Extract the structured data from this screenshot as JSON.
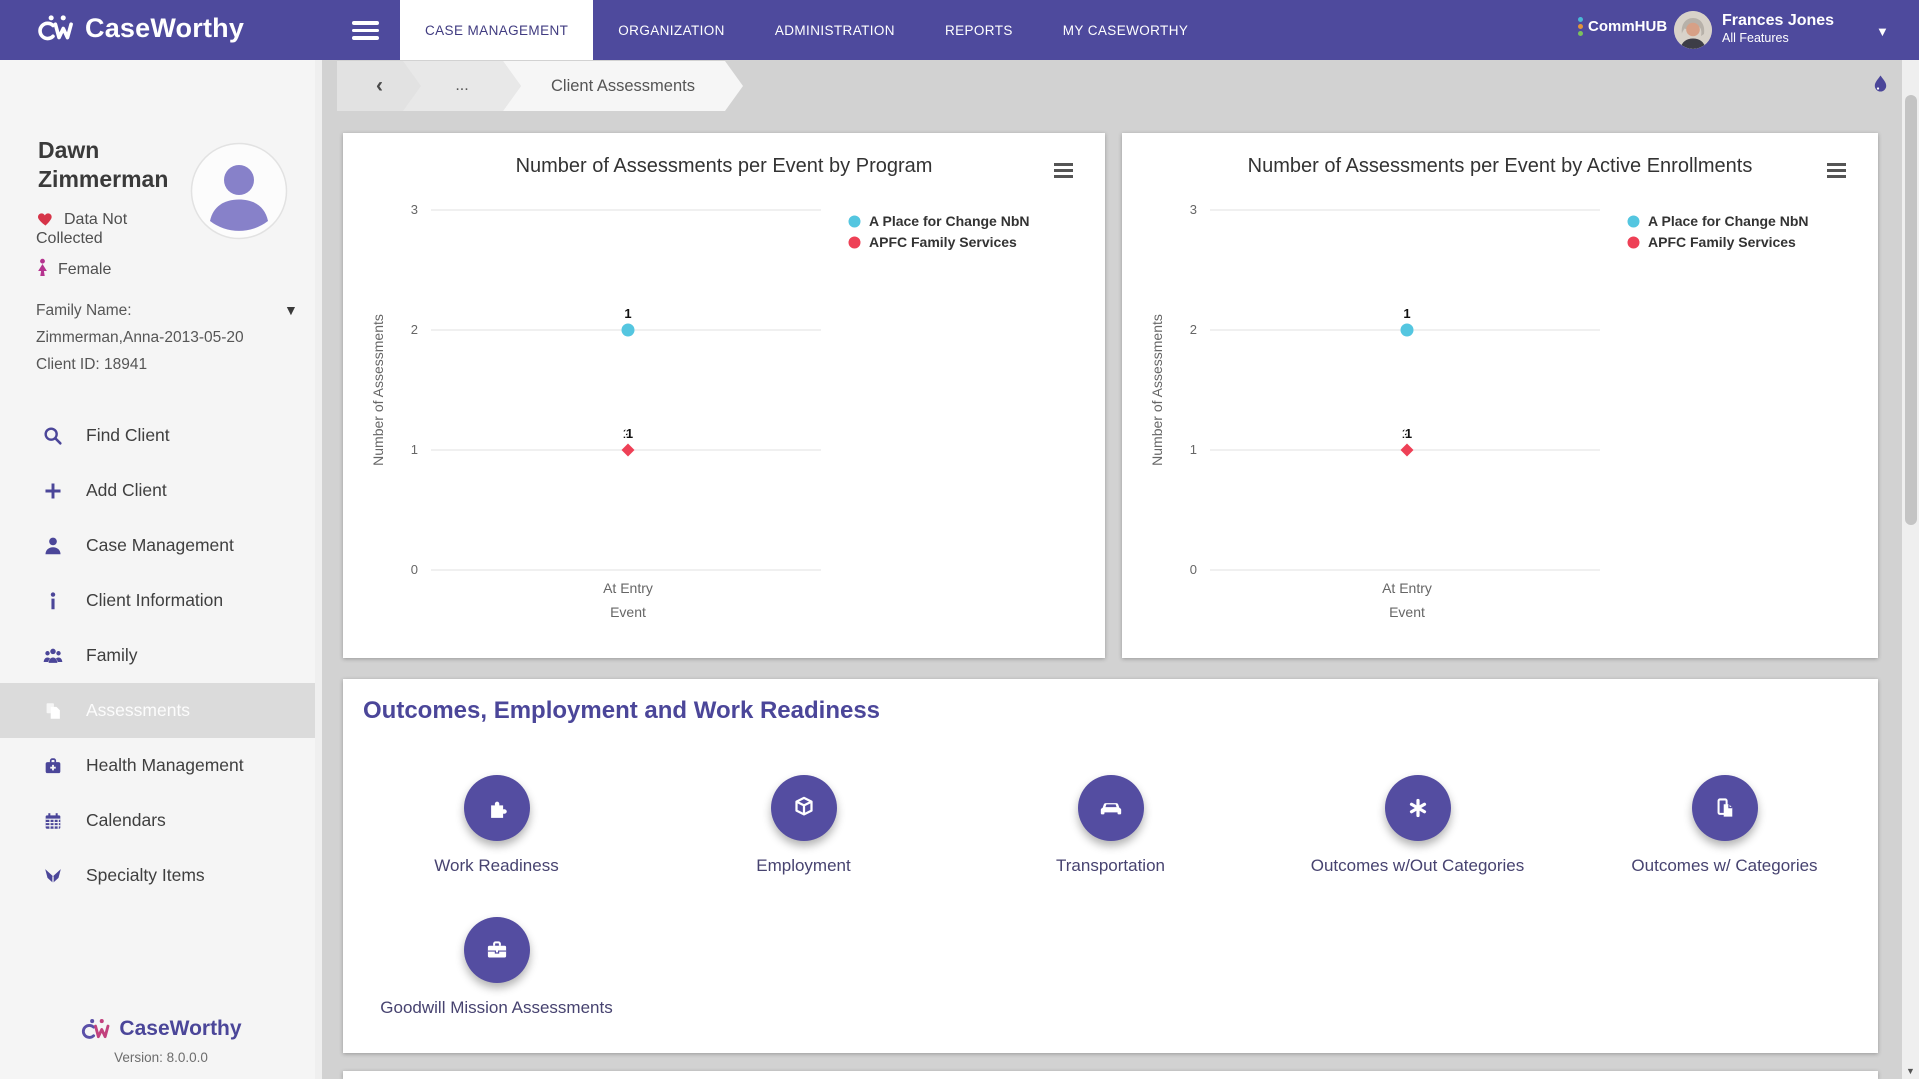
{
  "navbar": {
    "brand": "CaseWorthy",
    "tabs": [
      {
        "label": "CASE MANAGEMENT",
        "active": true
      },
      {
        "label": "ORGANIZATION",
        "active": false
      },
      {
        "label": "ADMINISTRATION",
        "active": false
      },
      {
        "label": "REPORTS",
        "active": false
      },
      {
        "label": "MY CASEWORTHY",
        "active": false
      }
    ],
    "commhub_label": "CommHUB",
    "user": {
      "name": "Frances Jones",
      "subtitle": "All Features"
    },
    "colors": {
      "bar": "#4e4a9d",
      "active_tab_text": "#403b80"
    }
  },
  "sidebar": {
    "client": {
      "name_line1": "Dawn",
      "name_line2": "Zimmerman",
      "health_status": "Data Not Collected",
      "gender": "Female",
      "family_label": "Family Name:",
      "family_value": "Zimmerman,Anna-2013-05-20",
      "client_id": "Client ID: 18941"
    },
    "items": [
      {
        "label": "Find Client",
        "icon": "search",
        "active": false
      },
      {
        "label": "Add Client",
        "icon": "plus",
        "active": false
      },
      {
        "label": "Case Management",
        "icon": "person",
        "active": false
      },
      {
        "label": "Client Information",
        "icon": "info",
        "active": false
      },
      {
        "label": "Family",
        "icon": "family",
        "active": false
      },
      {
        "label": "Assessments",
        "icon": "document",
        "active": true
      },
      {
        "label": "Health Management",
        "icon": "medical-bag",
        "active": false
      },
      {
        "label": "Calendars",
        "icon": "calendar",
        "active": false
      },
      {
        "label": "Specialty Items",
        "icon": "specialty",
        "active": false
      }
    ],
    "footer": {
      "brand": "CaseWorthy",
      "version": "Version: 8.0.0.0"
    },
    "colors": {
      "icon": "#4b4699",
      "heart": "#d63448",
      "female": "#b5338f"
    }
  },
  "breadcrumb": {
    "back": "‹",
    "ellipsis": "...",
    "current": "Client Assessments"
  },
  "chart_data": [
    {
      "type": "scatter",
      "title": "Number of Assessments per Event by Program",
      "categories": [
        "At Entry"
      ],
      "xlabel": "Event",
      "ylabel": "Number of Assessments",
      "ylim": [
        0,
        3
      ],
      "yticks": [
        0,
        1,
        2,
        3
      ],
      "grid": true,
      "legend_position": "right",
      "series": [
        {
          "name": "A Place for Change NbN",
          "color": "#54c6e0",
          "marker": "circle",
          "x": [
            "At Entry"
          ],
          "values": [
            2
          ],
          "data_labels": [
            "1"
          ],
          "label_overlap": false
        },
        {
          "name": "APFC Family Services",
          "color": "#ee4056",
          "marker": "diamond",
          "x": [
            "At Entry"
          ],
          "values": [
            1
          ],
          "data_labels": [
            "1"
          ],
          "label_overlap": true
        }
      ]
    },
    {
      "type": "scatter",
      "title": "Number of Assessments per Event by Active Enrollments",
      "categories": [
        "At Entry"
      ],
      "xlabel": "Event",
      "ylabel": "Number of Assessments",
      "ylim": [
        0,
        3
      ],
      "yticks": [
        0,
        1,
        2,
        3
      ],
      "grid": true,
      "legend_position": "right",
      "series": [
        {
          "name": "A Place for Change NbN",
          "color": "#54c6e0",
          "marker": "circle",
          "x": [
            "At Entry"
          ],
          "values": [
            2
          ],
          "data_labels": [
            "1"
          ],
          "label_overlap": false
        },
        {
          "name": "APFC Family Services",
          "color": "#ee4056",
          "marker": "diamond",
          "x": [
            "At Entry"
          ],
          "values": [
            1
          ],
          "data_labels": [
            "1"
          ],
          "label_overlap": true
        }
      ]
    }
  ],
  "outcomes": {
    "title": "Outcomes, Employment and Work Readiness",
    "accent": "#544da1",
    "items": [
      {
        "label": "Work Readiness",
        "icon": "puzzle"
      },
      {
        "label": "Employment",
        "icon": "cube"
      },
      {
        "label": "Transportation",
        "icon": "car"
      },
      {
        "label": "Outcomes w/Out Categories",
        "icon": "asterisk"
      },
      {
        "label": "Outcomes w/ Categories",
        "icon": "documents"
      },
      {
        "label": "Goodwill Mission Assessments",
        "icon": "briefcase"
      }
    ]
  }
}
